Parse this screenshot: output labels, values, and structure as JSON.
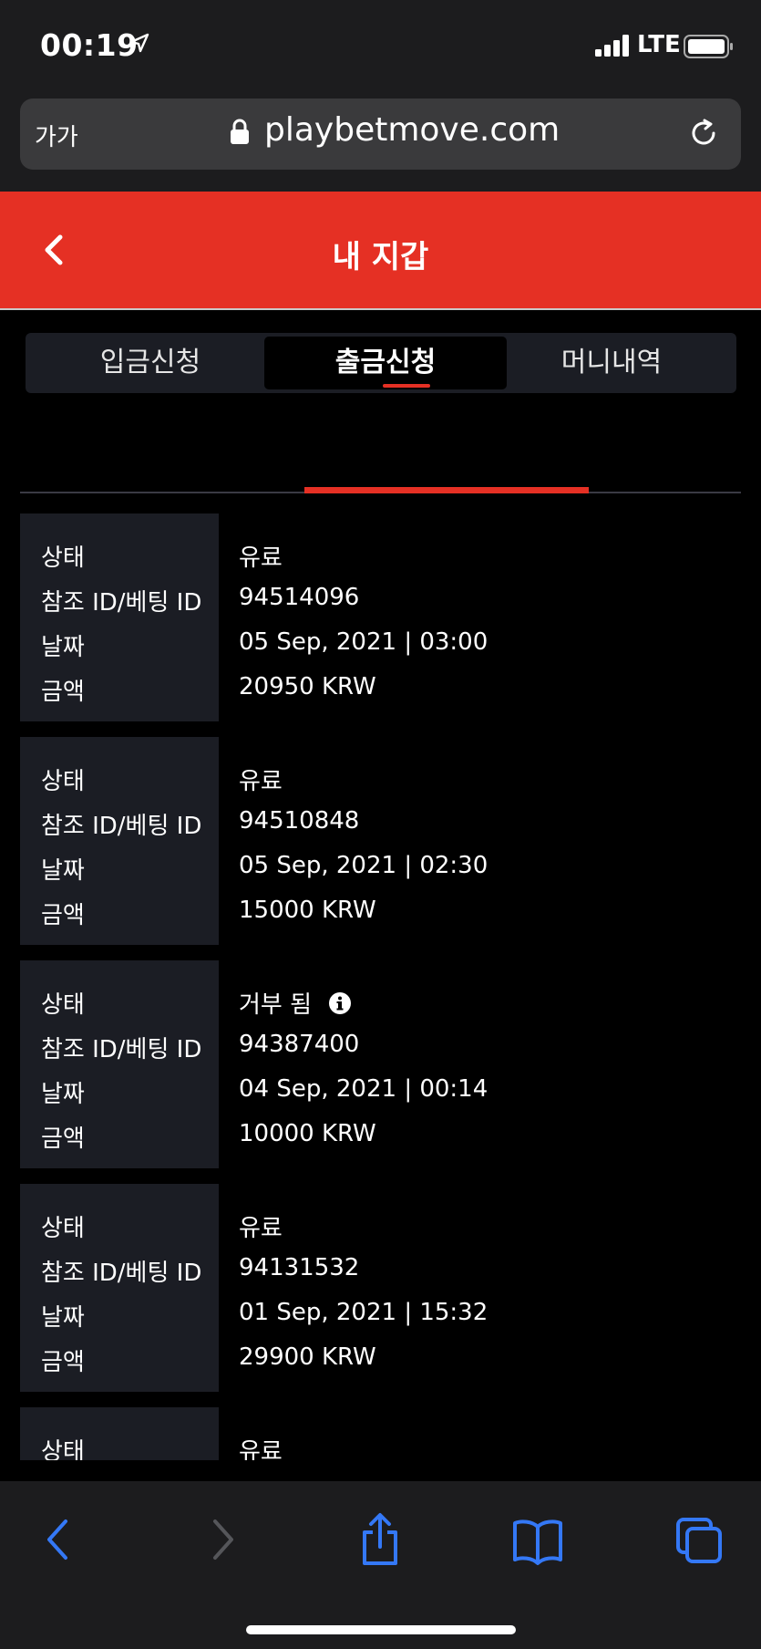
{
  "status_bar": {
    "time": "00:19",
    "network": "LTE"
  },
  "browser": {
    "text_size": "가가",
    "url": "playbetmove.com"
  },
  "header": {
    "title": "내 지갑"
  },
  "tabs": [
    {
      "label": "입금신청"
    },
    {
      "label": "출금신청",
      "active": true
    },
    {
      "label": "머니내역"
    }
  ],
  "labels": {
    "status": "상태",
    "ref_id": "참조 ID/베팅 ID",
    "date": "날짜",
    "amount": "금액"
  },
  "transactions": [
    {
      "status": "유료",
      "ref_id": "94514096",
      "date": "05 Sep, 2021 | 03:00",
      "amount": "20950 KRW"
    },
    {
      "status": "유료",
      "ref_id": "94510848",
      "date": "05 Sep, 2021 | 02:30",
      "amount": "15000 KRW"
    },
    {
      "status": "거부 됨",
      "ref_id": "94387400",
      "date": "04 Sep, 2021 | 00:14",
      "amount": "10000 KRW",
      "has_info": true
    },
    {
      "status": "유료",
      "ref_id": "94131532",
      "date": "01 Sep, 2021 | 15:32",
      "amount": "29900 KRW"
    },
    {
      "status": "유료"
    }
  ],
  "colors": {
    "accent": "#e53024",
    "card_label_bg": "#1b1d24",
    "ios_blue": "#3478f6"
  }
}
